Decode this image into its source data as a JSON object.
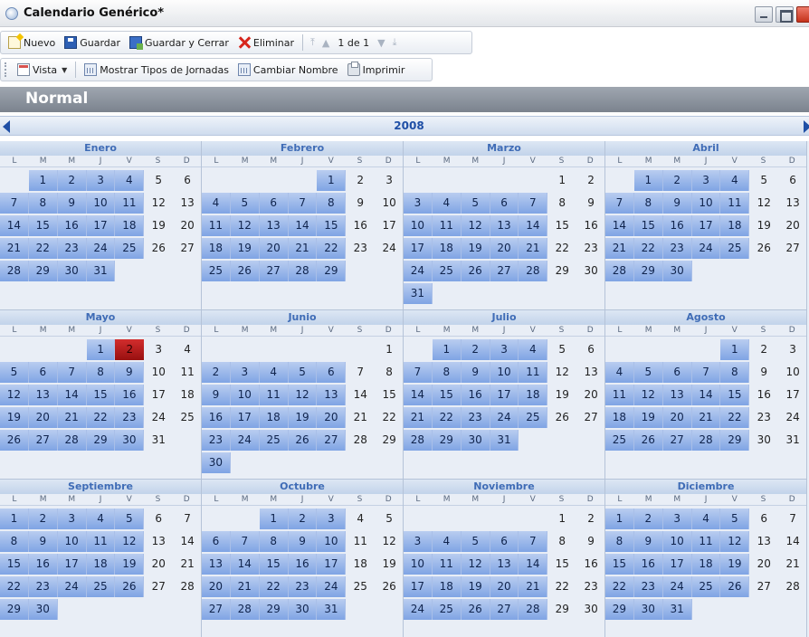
{
  "window": {
    "title": "Calendario Genérico*"
  },
  "toolbar1": {
    "new_label": "Nuevo",
    "save_label": "Guardar",
    "save_close_label": "Guardar y Cerrar",
    "delete_label": "Eliminar",
    "pager_text": "1 de 1"
  },
  "toolbar2": {
    "view_label": "Vista",
    "show_types_label": "Mostrar Tipos de Jornadas",
    "rename_label": "Cambiar Nombre",
    "print_label": "Imprimir"
  },
  "section": {
    "title": "Normal"
  },
  "calendar": {
    "year": "2008",
    "weekday_labels": [
      "L",
      "M",
      "M",
      "J",
      "V",
      "S",
      "D"
    ],
    "colors": {
      "work_day": "#8fb0e8",
      "holiday": "#c41f1f",
      "background": "#e9eef6"
    },
    "months": [
      {
        "name": "Enero",
        "first_weekday": 1,
        "days": 31,
        "holidays": []
      },
      {
        "name": "Febrero",
        "first_weekday": 4,
        "days": 29,
        "holidays": []
      },
      {
        "name": "Marzo",
        "first_weekday": 5,
        "days": 31,
        "holidays": []
      },
      {
        "name": "Abril",
        "first_weekday": 1,
        "days": 30,
        "holidays": []
      },
      {
        "name": "Mayo",
        "first_weekday": 3,
        "days": 31,
        "holidays": [
          2
        ]
      },
      {
        "name": "Junio",
        "first_weekday": 6,
        "days": 30,
        "holidays": []
      },
      {
        "name": "Julio",
        "first_weekday": 1,
        "days": 31,
        "holidays": []
      },
      {
        "name": "Agosto",
        "first_weekday": 4,
        "days": 31,
        "holidays": []
      },
      {
        "name": "Septiembre",
        "first_weekday": 0,
        "days": 30,
        "holidays": []
      },
      {
        "name": "Octubre",
        "first_weekday": 2,
        "days": 31,
        "holidays": []
      },
      {
        "name": "Noviembre",
        "first_weekday": 5,
        "days": 30,
        "holidays": []
      },
      {
        "name": "Diciembre",
        "first_weekday": 0,
        "days": 31,
        "holidays": []
      }
    ]
  }
}
